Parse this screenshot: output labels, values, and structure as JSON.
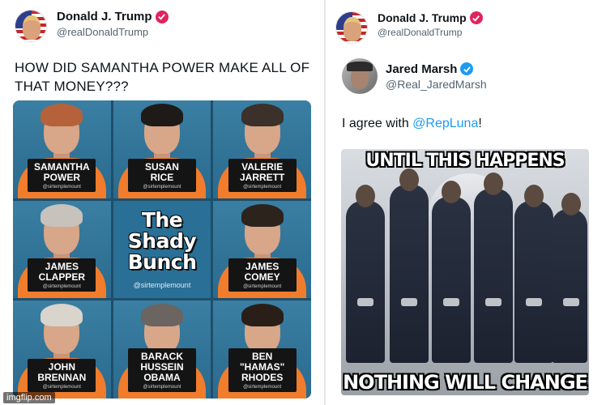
{
  "left_post": {
    "author_name": "Donald J. Trump",
    "author_handle": "@realDonaldTrump",
    "text": "HOW DID SAMANTHA POWER MAKE ALL OF THAT MONEY???",
    "image": {
      "title_lines": [
        "The",
        "Shady",
        "Bunch"
      ],
      "credit": "@sirtemplemount",
      "cells": [
        {
          "name": "SAMANTHA\nPOWER",
          "tag": "@sirtemplemount",
          "hair": "#b5623a"
        },
        {
          "name": "SUSAN\nRICE",
          "tag": "@sirtemplemount",
          "hair": "#1e1a17"
        },
        {
          "name": "VALERIE\nJARRETT",
          "tag": "@sirtemplemount",
          "hair": "#3b302a"
        },
        {
          "name": "JAMES\nCLAPPER",
          "tag": "@sirtemplemount",
          "hair": "#c7c2bb"
        },
        {
          "name": "JAMES\nCOMEY",
          "tag": "@sirtemplemount",
          "hair": "#2c231d"
        },
        {
          "name": "JOHN\nBRENNAN",
          "tag": "@sirtemplemount",
          "hair": "#d9d4cc"
        },
        {
          "name": "BARACK\nHUSSEIN OBAMA",
          "tag": "@sirtemplemount",
          "hair": "#6b6460"
        },
        {
          "name": "BEN \"HAMAS\"\nRHODES",
          "tag": "@sirtemplemount",
          "hair": "#2a1f18"
        }
      ]
    }
  },
  "right_post": {
    "author_name": "Donald J. Trump",
    "author_handle": "@realDonaldTrump",
    "quoted": {
      "author_name": "Jared Marsh",
      "author_handle": "@Real_JaredMarsh",
      "text_before": "I agree with ",
      "mention": "@RepLuna",
      "text_after": "!",
      "meme_top": "UNTIL THIS HAPPENS",
      "meme_bottom": "NOTHING WILL CHANGE"
    }
  },
  "colors": {
    "verified_red": "#e0245e",
    "verified_blue": "#1d9bf0",
    "jumpsuit_orange": "#f07c2c",
    "grid_blue": "#1e4f6b"
  },
  "icons": [
    "verified-badge-icon",
    "checkmark-icon"
  ],
  "watermark": "imgflip.com"
}
